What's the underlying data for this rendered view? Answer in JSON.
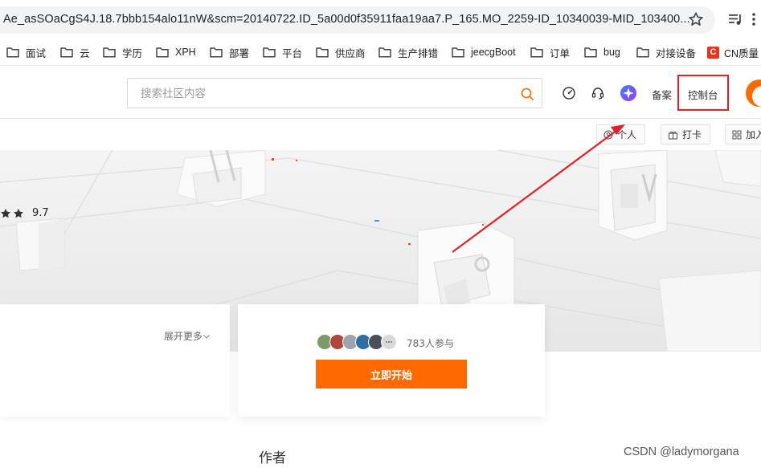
{
  "browser": {
    "url": "Ae_asSOaCgS4J.18.7bbb154alo11nW&scm=20140722.ID_5a00d0f35911faa19aa7.P_165.MO_2259-ID_10340039-MID_103400..."
  },
  "bookmarks": [
    {
      "label": "面试"
    },
    {
      "label": "云"
    },
    {
      "label": "学历"
    },
    {
      "label": "XPH"
    },
    {
      "label": "部署"
    },
    {
      "label": "平台"
    },
    {
      "label": "供应商"
    },
    {
      "label": "生产排错"
    },
    {
      "label": "jeecgBoot"
    },
    {
      "label": "订单"
    },
    {
      "label": "bug"
    },
    {
      "label": "对接设备"
    },
    {
      "label": "CN质量",
      "logo": "C"
    }
  ],
  "header": {
    "search_placeholder": "搜索社区内容",
    "filing_label": "备案",
    "console_label": "控制台"
  },
  "subbar": {
    "personal_label": "个人",
    "checkin_label": "打卡",
    "join_label": "加入"
  },
  "course": {
    "rating": "9.7",
    "expand_label": "展开更多",
    "participants": "783人参与",
    "start_label": "立即开始",
    "author_heading": "作者"
  },
  "watermark": "CSDN @ladymorgana",
  "colors": {
    "brand": "#ff6a00",
    "highlight": "#e2202a"
  }
}
